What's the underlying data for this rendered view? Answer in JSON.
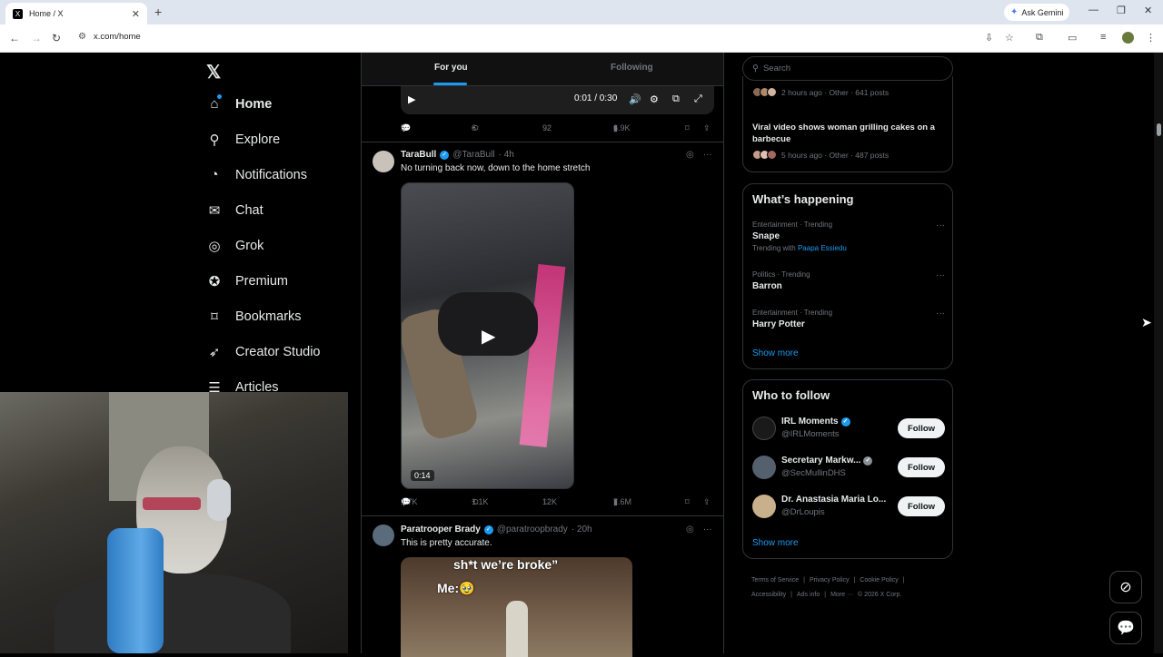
{
  "browser": {
    "tab_title": "Home / X",
    "tab_close": "✕",
    "new_tab": "+",
    "ask_gemini": "Ask Gemini",
    "url": "x.com/home",
    "window_controls": [
      "—",
      "❐",
      "✕"
    ]
  },
  "nav": {
    "logo": "𝕏",
    "items": [
      {
        "label": "Home",
        "icon": "home-icon",
        "glyph": "⌂"
      },
      {
        "label": "Explore",
        "icon": "search-icon",
        "glyph": "⚲"
      },
      {
        "label": "Notifications",
        "icon": "bell-icon",
        "glyph": "🔔"
      },
      {
        "label": "Chat",
        "icon": "mail-icon",
        "glyph": "✉"
      },
      {
        "label": "Grok",
        "icon": "grok-icon",
        "glyph": "◎"
      },
      {
        "label": "Premium",
        "icon": "premium-icon",
        "glyph": "✪"
      },
      {
        "label": "Bookmarks",
        "icon": "bookmark-icon",
        "glyph": "⌑"
      },
      {
        "label": "Creator Studio",
        "icon": "rocket-icon",
        "glyph": "➶"
      },
      {
        "label": "Articles",
        "icon": "articles-icon",
        "glyph": "☰"
      }
    ]
  },
  "feed": {
    "tabs": [
      "For you",
      "Following"
    ],
    "video1": {
      "time": "0:01 / 0:30"
    },
    "post0_actions": {
      "replies": "5",
      "reposts": "6",
      "likes": "92",
      "views": "6.9K"
    },
    "post1": {
      "name": "TaraBull",
      "handle": "@TaraBull",
      "time": "· 4h",
      "text": "No turning back now, down to the home stretch",
      "video_duration": "0:14",
      "replies": "1.7K",
      "reposts": "1.1K",
      "likes": "12K",
      "views": "7.6M"
    },
    "post2": {
      "name": "Paratrooper Brady",
      "handle": "@paratroopbrady",
      "time": "· 20h",
      "text": "This is pretty accurate.",
      "meme_caption_top": "sh*t we’re broke”",
      "meme_caption_bottom": "Me:🥹"
    }
  },
  "sidebar": {
    "search_placeholder": "Search",
    "news": [
      {
        "meta": "2 hours ago · Other · 641 posts"
      },
      {
        "title": "Viral video shows woman grilling cakes on a barbecue",
        "meta": "5 hours ago · Other · 487 posts"
      }
    ],
    "happening": {
      "title": "What’s happening",
      "trends": [
        {
          "category": "Entertainment · Trending",
          "name": "Snape",
          "with_label": "Trending with",
          "with_name": "Paapa Essiedu"
        },
        {
          "category": "Politics · Trending",
          "name": "Barron"
        },
        {
          "category": "Entertainment · Trending",
          "name": "Harry Potter"
        }
      ],
      "show_more": "Show more"
    },
    "who_to_follow": {
      "title": "Who to follow",
      "accounts": [
        {
          "name": "IRL Moments",
          "handle": "@IRLMoments",
          "button": "Follow"
        },
        {
          "name": "Secretary Markw...",
          "handle": "@SecMullinDHS",
          "button": "Follow"
        },
        {
          "name": "Dr. Anastasia Maria Lo...",
          "handle": "@DrLoupis",
          "button": "Follow"
        }
      ],
      "show_more": "Show more"
    },
    "footer": {
      "links": [
        "Terms of Service",
        "|",
        "Privacy Policy",
        "|",
        "Cookie Policy",
        "|",
        "Accessibility",
        "|",
        "Ads info",
        "|",
        "More ···",
        "© 2026 X Corp."
      ]
    }
  },
  "colors": {
    "accent": "#1d9bf0",
    "background": "#000000",
    "border": "#2f3336"
  }
}
